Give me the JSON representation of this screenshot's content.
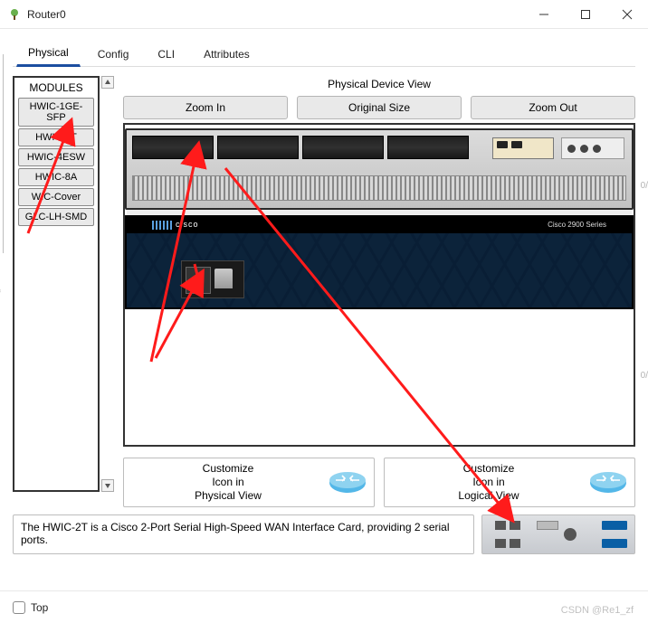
{
  "window": {
    "title": "Router0"
  },
  "tabs": [
    "Physical",
    "Config",
    "CLI",
    "Attributes"
  ],
  "active_tab_index": 0,
  "modules": {
    "header": "MODULES",
    "items": [
      "HWIC-1GE-SFP",
      "HWIC-2T",
      "HWIC-4ESW",
      "HWIC-8A",
      "WIC-Cover",
      "GLC-LH-SMD"
    ]
  },
  "device_view": {
    "label": "Physical Device View",
    "zoom_in": "Zoom In",
    "original": "Original Size",
    "zoom_out": "Zoom Out",
    "brand": "cisco",
    "series": "Cisco 2900 Series"
  },
  "customize": {
    "physical_l1": "Customize",
    "physical_l2": "Icon in",
    "physical_l3": "Physical View",
    "logical_l1": "Customize",
    "logical_l2": "Icon in",
    "logical_l3": "Logical View"
  },
  "description": "The HWIC-2T is a Cisco 2-Port Serial High-Speed WAN Interface Card, providing 2 serial ports.",
  "bottom": {
    "top_checkbox": "Top"
  },
  "watermark": "CSDN @Re1_zf",
  "bg_labels": {
    "r1": "0/",
    "r2": "0/"
  }
}
